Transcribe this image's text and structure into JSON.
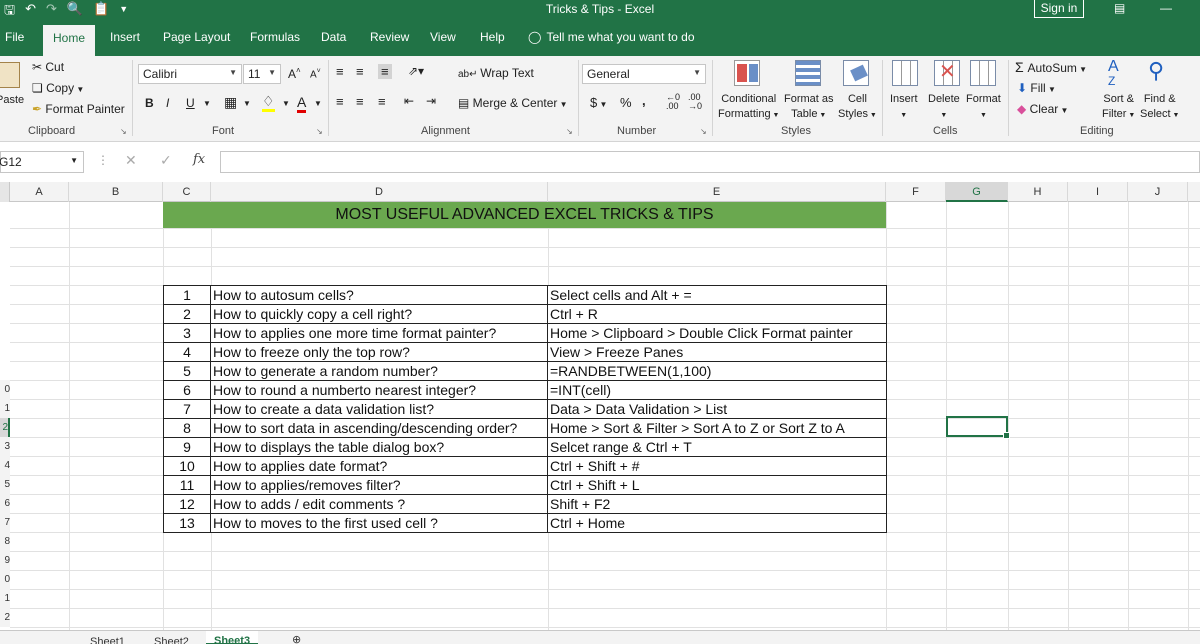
{
  "window": {
    "title": "Tricks & Tips  -  Excel",
    "sign_in": "Sign in"
  },
  "tabs": [
    "File",
    "Home",
    "Insert",
    "Page Layout",
    "Formulas",
    "Data",
    "Review",
    "View",
    "Help"
  ],
  "tell_me": "Tell me what you want to do",
  "ribbon": {
    "clipboard": {
      "paste": "Paste",
      "cut": "Cut",
      "copy": "Copy",
      "format_painter": "Format Painter",
      "label": "Clipboard"
    },
    "font": {
      "name": "Calibri",
      "size": "11",
      "bold": "B",
      "italic": "I",
      "underline": "U",
      "grow": "A",
      "shrink": "A",
      "label": "Font"
    },
    "alignment": {
      "wrap_text": "Wrap Text",
      "merge_center": "Merge & Center",
      "label": "Alignment"
    },
    "number": {
      "format": "General",
      "currency": "$",
      "percent": "%",
      "comma": ",",
      "label": "Number"
    },
    "styles": {
      "conditional_1": "Conditional",
      "conditional_2": "Formatting",
      "format_as_1": "Format as",
      "format_as_2": "Table",
      "cell_1": "Cell",
      "cell_2": "Styles",
      "label": "Styles"
    },
    "cells": {
      "insert": "Insert",
      "delete": "Delete",
      "format": "Format",
      "label": "Cells"
    },
    "editing": {
      "autosum": "AutoSum",
      "fill": "Fill",
      "clear": "Clear",
      "sort_1": "Sort &",
      "sort_2": "Filter",
      "find_1": "Find &",
      "find_2": "Select",
      "label": "Editing"
    }
  },
  "formula_bar": {
    "name_box": "G12",
    "fx": "fx",
    "value": ""
  },
  "columns": [
    "A",
    "B",
    "C",
    "D",
    "E",
    "F",
    "G",
    "H",
    "I",
    "J"
  ],
  "row_numbers": [
    "0",
    "1",
    "2",
    "3",
    "4",
    "5",
    "6",
    "7",
    "8",
    "9",
    "0",
    "1",
    "2"
  ],
  "banner": "MOST USEFUL ADVANCED EXCEL TRICKS & TIPS",
  "tips": [
    {
      "n": "1",
      "q": "How to autosum cells?",
      "a": "Select cells and Alt + ="
    },
    {
      "n": "2",
      "q": "How to quickly copy a cell right?",
      "a": "Ctrl + R"
    },
    {
      "n": "3",
      "q": "How to applies one more time format painter?",
      "a": "Home > Clipboard > Double Click Format painter"
    },
    {
      "n": "4",
      "q": "How to freeze only the top row?",
      "a": "View > Freeze Panes"
    },
    {
      "n": "5",
      "q": "How to generate a random number?",
      "a": "=RANDBETWEEN(1,100)"
    },
    {
      "n": "6",
      "q": "How to round a numberto nearest integer?",
      "a": "=INT(cell)"
    },
    {
      "n": "7",
      "q": "How to create a data validation list?",
      "a": "Data > Data Validation > List"
    },
    {
      "n": "8",
      "q": "How to sort data in ascending/descending order?",
      "a": "Home > Sort & Filter > Sort A to Z or Sort Z to A"
    },
    {
      "n": "9",
      "q": "How to displays the table dialog box?",
      "a": "Selcet range & Ctrl + T"
    },
    {
      "n": "10",
      "q": "How to applies date format?",
      "a": "Ctrl + Shift + #"
    },
    {
      "n": "11",
      "q": "How to applies/removes filter?",
      "a": "Ctrl + Shift + L"
    },
    {
      "n": "12",
      "q": "How to adds / edit comments  ?",
      "a": "Shift + F2"
    },
    {
      "n": "13",
      "q": "How to moves to the first used cell ?",
      "a": "Ctrl + Home"
    }
  ],
  "sheets": [
    "Sheet1",
    "Sheet2",
    "Sheet3"
  ],
  "colors": {
    "brand": "#217346",
    "banner": "#6aa84f"
  }
}
